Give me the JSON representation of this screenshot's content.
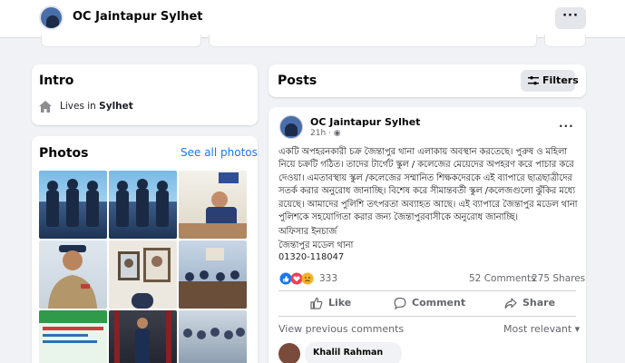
{
  "header": {
    "page_name": "OC Jaintapur Sylhet",
    "more_label": "···"
  },
  "intro": {
    "title": "Intro",
    "lives_prefix": "Lives in ",
    "lives_city": "Sylhet"
  },
  "photos": {
    "title": "Photos",
    "see_all": "See all photos"
  },
  "posts": {
    "title": "Posts",
    "filters_label": "Filters"
  },
  "post": {
    "author": "OC Jaintapur Sylhet",
    "time": "21h · ◉",
    "more_label": "···",
    "body": "একটি অপহরনকারী চক্র জৈন্তাপুর থানা এলাকায় অবস্থান করতেছে। পুরুষ ও মহিলা নিয়ে চক্রটি গঠিত। তাদের টার্গেট স্কুল / কলেজের মেয়েদের অপহরণ করে পাচার করে দেওয়া। এমতাবস্থায় স্কুল /কলেজের সম্মানিত শিক্ষকদেরকে এই ব্যাপারে ছাত্রছাত্রীদের সতর্ক করার অনুরোধ জানাচ্ছি। বিশেষ করে সীমান্তবর্তী স্কুল /কলেজগুলো ঝুঁকির মধ্যে রয়েছে। আমাদের পুলিশি তৎপরতা অব্যাহত আছে। এই ব্যাপারে জৈন্তাপুর মডেল থানা পুলিশকে সহযোগিতা করার জন্য জৈন্তাপুরবাসীকে অনুরোধ জানাচ্ছি।",
    "sig_1": "অফিসার ইনচার্জ",
    "sig_2": "জৈন্তাপুর মডেল থানা",
    "sig_3": "01320-118047",
    "reactions_count": "333",
    "comments_count": "52 Comments",
    "shares_count": "275 Shares",
    "like_label": "Like",
    "comment_label": "Comment",
    "share_label": "Share",
    "view_previous": "View previous comments",
    "most_relevant": "Most relevant ▾",
    "commenter_name": "Khalil Rahman"
  },
  "colors": {
    "accent": "#1877f2",
    "bg": "#f0f2f5",
    "muted": "#65676b"
  },
  "icons": [
    "home-icon",
    "filters-icon",
    "globe-icon",
    "like-icon",
    "comment-icon",
    "share-icon"
  ]
}
